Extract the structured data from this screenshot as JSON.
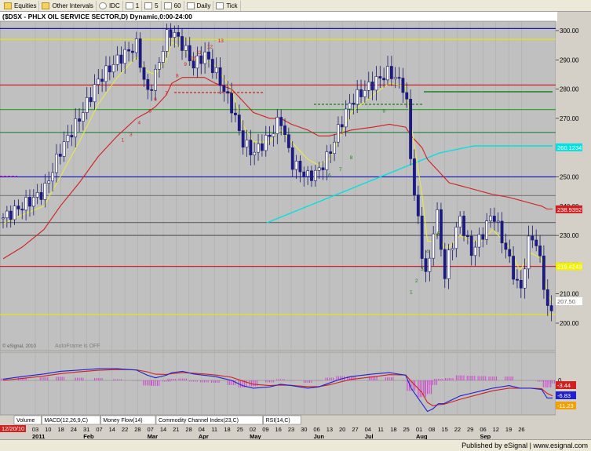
{
  "toolbar": {
    "items": [
      {
        "label": "Equities",
        "icon": "folder-icon"
      },
      {
        "label": "Other Intervals",
        "icon": "folder-icon"
      },
      {
        "label": "IDC",
        "icon": "circle-icon"
      },
      {
        "label": "1",
        "icon": "square-icon"
      },
      {
        "label": "5",
        "icon": "square-icon"
      },
      {
        "label": "60",
        "icon": "square-icon"
      },
      {
        "label": "Daily",
        "icon": "square-icon"
      },
      {
        "label": "Tick",
        "icon": "square-icon"
      }
    ]
  },
  "chart_title": "($DSX - PHLX OIL SERVICE SECTOR,D) Dynamic,0:00-24:00",
  "watermarks": {
    "copyright": "© eSignal, 2010",
    "autoframe": "AutoFrame is OFF"
  },
  "footer": "Published by eSignal | www.esignal.com",
  "panel_tabs": [
    "Volume",
    "MACD(12,26,9,C)",
    "Money Flow(14)",
    "Commodity Channel Index(23,C)",
    "RSI(14,C)"
  ],
  "date_box": "12/20/10",
  "chart_data": {
    "type": "line",
    "title": "($DSX - PHLX OIL SERVICE SECTOR,D) Dynamic,0:00-24:00",
    "xlabel": "",
    "ylabel": "",
    "ylim": [
      191,
      304
    ],
    "yticks": [
      200,
      210,
      220,
      230,
      240,
      250,
      260,
      270,
      280,
      290,
      300
    ],
    "x_tick_labels": [
      "03",
      "10",
      "18",
      "24",
      "31",
      "07",
      "14",
      "22",
      "28",
      "07",
      "14",
      "21",
      "28",
      "04",
      "11",
      "18",
      "25",
      "02",
      "09",
      "16",
      "23",
      "30",
      "06",
      "13",
      "20",
      "27",
      "04",
      "11",
      "18",
      "25",
      "01",
      "08",
      "15",
      "22",
      "29",
      "06",
      "12",
      "19",
      "26"
    ],
    "month_labels": [
      "2011",
      "Feb",
      "Mar",
      "Apr",
      "May",
      "Jun",
      "Jul",
      "Aug",
      "Sep"
    ],
    "close_path_days": [
      0,
      7,
      15,
      21,
      28,
      35,
      42,
      49,
      53,
      56,
      60,
      62,
      66,
      70,
      74,
      78,
      84,
      88,
      92,
      98,
      102,
      106,
      112,
      116,
      120,
      124,
      128,
      136,
      142,
      148,
      150,
      154,
      156,
      158,
      160,
      162,
      164,
      168,
      172,
      176,
      180,
      186,
      190,
      194,
      198,
      200,
      202
    ],
    "close_path_values": [
      236,
      240,
      245,
      259,
      270,
      283,
      290,
      295,
      278,
      285,
      298,
      300,
      295,
      288,
      292,
      286,
      274,
      262,
      258,
      264,
      270,
      255,
      250,
      252,
      258,
      268,
      276,
      282,
      286,
      280,
      254,
      224,
      214,
      232,
      238,
      214,
      224,
      236,
      224,
      230,
      238,
      222,
      210,
      232,
      220,
      204,
      205
    ],
    "ma_fast_values": [
      234,
      237,
      240,
      250,
      262,
      275,
      284,
      291,
      286,
      285,
      290,
      296,
      294,
      290,
      290,
      288,
      280,
      268,
      262,
      262,
      266,
      262,
      256,
      254,
      256,
      264,
      272,
      278,
      282,
      281,
      268,
      244,
      228,
      228,
      232,
      226,
      226,
      230,
      228,
      228,
      232,
      226,
      218,
      224,
      222,
      210,
      207
    ],
    "ma_slow_values": [
      222,
      226,
      232,
      240,
      248,
      257,
      264,
      270,
      272,
      274,
      278,
      282,
      284,
      284,
      284,
      282,
      280,
      276,
      272,
      270,
      270,
      268,
      266,
      264,
      264,
      265,
      266,
      267,
      268,
      267,
      264,
      260,
      256,
      254,
      252,
      250,
      248,
      247,
      246,
      245,
      244,
      243,
      242,
      241,
      240,
      239,
      239
    ],
    "horizontal_levels": [
      {
        "value": 300.7,
        "color": "#1a1aa8"
      },
      {
        "value": 297,
        "color": "#e8e800"
      },
      {
        "value": 281.4,
        "color": "#d02020"
      },
      {
        "value": 273,
        "color": "#20a020"
      },
      {
        "value": 265.2,
        "color": "#208040"
      },
      {
        "value": 250,
        "color": "#2020c0"
      },
      {
        "value": 243.6,
        "color": "#808080"
      },
      {
        "value": 234.4,
        "color": "#606060"
      },
      {
        "value": 230,
        "color": "#606060"
      },
      {
        "value": 219.4,
        "color": "#d02020"
      },
      {
        "value": 203,
        "color": "#e8e800"
      }
    ],
    "price_labels": [
      {
        "value": "238.9392",
        "bg": "#d02020",
        "fg": "#ffffff",
        "y": 238.9
      },
      {
        "value": "260.1234",
        "bg": "#00e0e0",
        "fg": "#ffffff",
        "y": 260.1
      },
      {
        "value": "219.4243",
        "bg": "#f0f000",
        "fg": "#ffffff",
        "y": 219.4
      },
      {
        "value": "207.50",
        "bg": "#ffffff",
        "fg": "#606060",
        "y": 207.5
      }
    ],
    "macd_labels": [
      {
        "value": "-3.44",
        "bg": "#d02020"
      },
      {
        "value": "-6.83",
        "bg": "#2020d0"
      },
      {
        "value": "-11.23",
        "bg": "#f0a000"
      }
    ],
    "macd_zero_label": "0",
    "macd_line": [
      0.5,
      1.5,
      2.5,
      3.5,
      4,
      4.5,
      4.5,
      4,
      2,
      1,
      2,
      3,
      3.5,
      2.5,
      2,
      1.5,
      0,
      -2,
      -3,
      -2.5,
      -1.5,
      -2,
      -3,
      -2.5,
      -1,
      0.5,
      1.5,
      2.5,
      3,
      2,
      -3,
      -9,
      -12,
      -11,
      -9,
      -9,
      -8,
      -6,
      -5,
      -4,
      -3,
      -2,
      -3,
      -3,
      -3.5,
      -6.8,
      -6.8
    ],
    "signal_line": [
      0,
      0.8,
      1.7,
      2.6,
      3.3,
      3.9,
      4.2,
      4.1,
      3.3,
      2.4,
      2.3,
      2.6,
      3,
      2.8,
      2.5,
      2.1,
      1.2,
      -0.2,
      -1.5,
      -2,
      -1.8,
      -1.9,
      -2.4,
      -2.4,
      -1.7,
      -0.6,
      0.4,
      1.4,
      2.2,
      2.1,
      -0.3,
      -4.7,
      -8.5,
      -9.8,
      -9.4,
      -9.2,
      -8.6,
      -7.3,
      -6.2,
      -5.1,
      -4,
      -3,
      -3,
      -3,
      -3.2,
      -5,
      -6
    ],
    "demark_red_labels": [
      "1",
      "3",
      "4",
      "5",
      "6",
      "7",
      "8",
      "9",
      "10",
      "11",
      "12",
      "13"
    ],
    "demark_green_labels": [
      "1",
      "2",
      "3",
      "4",
      "5",
      "6",
      "7",
      "8",
      "9"
    ]
  }
}
